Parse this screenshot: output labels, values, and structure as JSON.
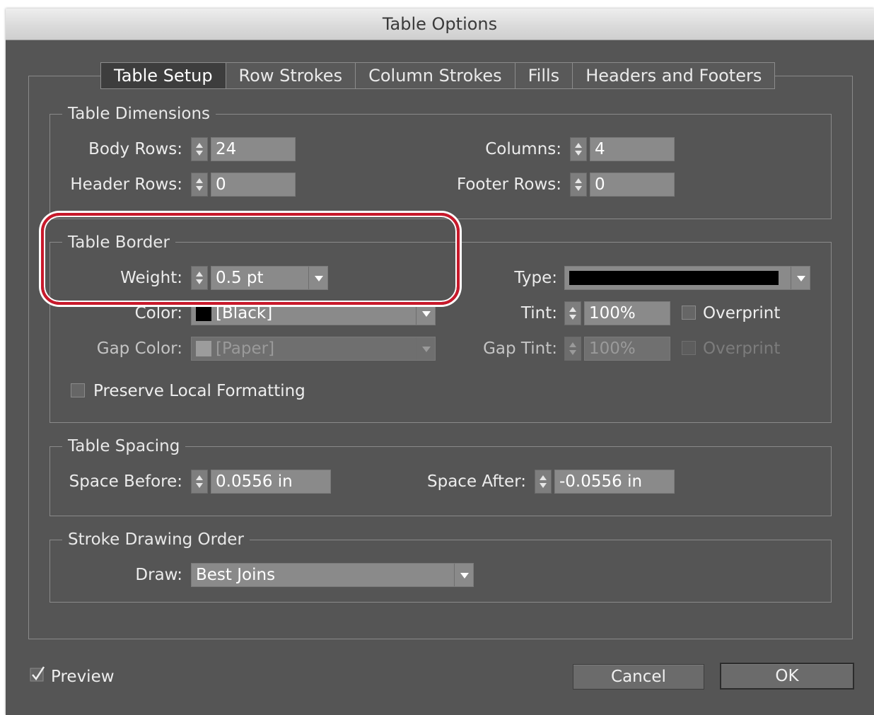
{
  "window": {
    "title": "Table Options"
  },
  "tabs": [
    {
      "label": "Table Setup",
      "active": true
    },
    {
      "label": "Row Strokes",
      "active": false
    },
    {
      "label": "Column Strokes",
      "active": false
    },
    {
      "label": "Fills",
      "active": false
    },
    {
      "label": "Headers and Footers",
      "active": false
    }
  ],
  "table_dimensions": {
    "legend": "Table Dimensions",
    "body_rows_label": "Body Rows:",
    "body_rows": "24",
    "header_rows_label": "Header Rows:",
    "header_rows": "0",
    "columns_label": "Columns:",
    "columns": "4",
    "footer_rows_label": "Footer Rows:",
    "footer_rows": "0"
  },
  "table_border": {
    "legend": "Table Border",
    "weight_label": "Weight:",
    "weight": "0.5 pt",
    "type_label": "Type:",
    "color_label": "Color:",
    "color": "[Black]",
    "color_swatch": "#000000",
    "tint_label": "Tint:",
    "tint": "100%",
    "overprint_label": "Overprint",
    "overprint_checked": false,
    "gap_color_label": "Gap Color:",
    "gap_color": "[Paper]",
    "gap_color_swatch": "#9c9c9c",
    "gap_tint_label": "Gap Tint:",
    "gap_tint": "100%",
    "gap_overprint_label": "Overprint",
    "gap_overprint_checked": false,
    "preserve_label": "Preserve Local Formatting",
    "preserve_checked": false
  },
  "table_spacing": {
    "legend": "Table Spacing",
    "space_before_label": "Space Before:",
    "space_before": "0.0556 in",
    "space_after_label": "Space After:",
    "space_after": "-0.0556 in"
  },
  "stroke_order": {
    "legend": "Stroke Drawing Order",
    "draw_label": "Draw:",
    "draw": "Best Joins"
  },
  "footer": {
    "preview_label": "Preview",
    "preview_checked": true,
    "cancel_label": "Cancel",
    "ok_label": "OK"
  },
  "colors": {
    "highlight": "#c8192b",
    "dialog_bg": "#555555"
  }
}
